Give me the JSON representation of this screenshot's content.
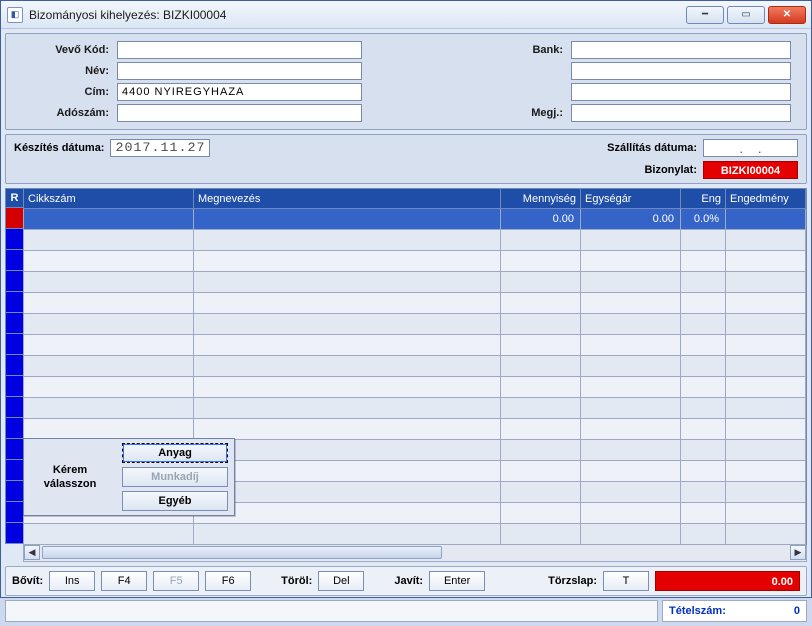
{
  "window": {
    "title": "Bizományosi kihelyezés:  BIZKI00004"
  },
  "customer": {
    "kod_label": "Vevő  Kód:",
    "nev_label": "Név:",
    "cim_label": "Cím:",
    "adoszam_label": "Adószám:",
    "kod": "",
    "nev": "",
    "cim": "4400 NYIREGYHAZA",
    "adoszam": "",
    "bank_label": "Bank:",
    "bank1": "",
    "bank2": "",
    "bank3": "",
    "megj_label": "Megj.:",
    "megj": ""
  },
  "dates": {
    "created_label": "Készítés dátuma:",
    "created": "2017.11.27",
    "ship_label": "Szállítás dátuma:",
    "ship": ".    ."
  },
  "doc": {
    "label": "Bizonylat:",
    "value": "BIZKI00004"
  },
  "grid": {
    "headers": {
      "r": "R",
      "cikkszam": "Cikkszám",
      "megnevezes": "Megnevezés",
      "mennyiseg": "Mennyiség",
      "egysegar": "Egységár",
      "eng": "Eng",
      "engedmeny": "Engedmény"
    },
    "row0": {
      "cikk": "",
      "megn": "",
      "menny": "0.00",
      "egysegar": "0.00",
      "eng": "0.0%",
      "enged": ""
    }
  },
  "dialog": {
    "prompt": "Kérem válasszon",
    "anyag": "Anyag",
    "munkadij": "Munkadíj",
    "egyeb": "Egyéb"
  },
  "toolbar": {
    "bovit": "Bővít:",
    "ins": "Ins",
    "f4": "F4",
    "f5": "F5",
    "f6": "F6",
    "torol": "Töröl:",
    "del": "Del",
    "javit": "Javít:",
    "enter": "Enter",
    "torzslap": "Törzslap:",
    "t": "T",
    "total": "0.00"
  },
  "status": {
    "count_label": "Tételszám:",
    "count_value": "0"
  }
}
